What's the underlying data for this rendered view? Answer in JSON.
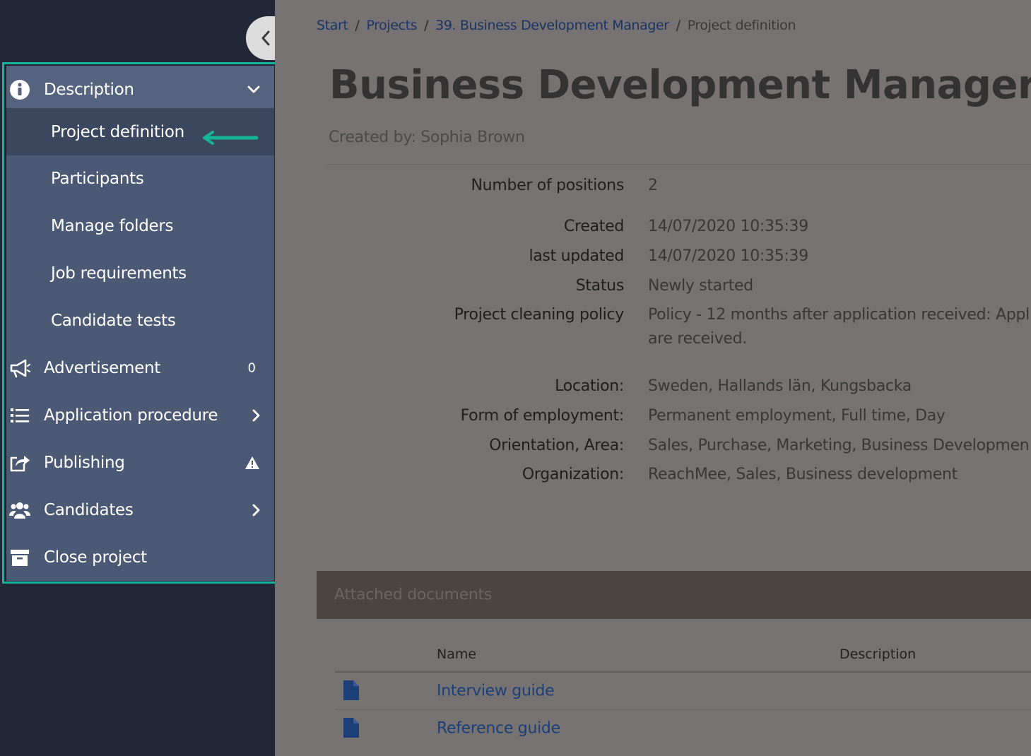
{
  "sidebar": {
    "items": [
      {
        "label": "Description",
        "icon": "info-circle-icon",
        "indicator": "chevron-down-icon"
      },
      {
        "label": "Project definition",
        "active": true
      },
      {
        "label": "Participants"
      },
      {
        "label": "Manage folders"
      },
      {
        "label": "Job requirements"
      },
      {
        "label": "Candidate tests"
      },
      {
        "label": "Advertisement",
        "icon": "megaphone-icon",
        "count": "0"
      },
      {
        "label": "Application procedure",
        "icon": "list-icon",
        "indicator": "chevron-right-icon"
      },
      {
        "label": "Publishing",
        "icon": "share-icon",
        "indicator": "warning-icon"
      },
      {
        "label": "Candidates",
        "icon": "users-icon",
        "indicator": "chevron-right-icon"
      },
      {
        "label": "Close project",
        "icon": "archive-icon"
      }
    ],
    "highlight_color": "#17b49c"
  },
  "breadcrumb": {
    "start": "Start",
    "projects": "Projects",
    "project": "39. Business Development Manager",
    "current": "Project definition"
  },
  "project": {
    "title": "Business Development Manager",
    "id": "(39)",
    "created_by": "Created by: Sophia Brown"
  },
  "details": [
    {
      "label": "Number of positions",
      "value": "2"
    },
    {
      "label": "Created",
      "value": "14/07/2020 10:35:39"
    },
    {
      "label": "last updated",
      "value": "14/07/2020 10:35:39"
    },
    {
      "label": "Status",
      "value": "Newly started"
    },
    {
      "label": "Project cleaning policy",
      "value": "Policy - 12 months after application received: Appl",
      "value2": "are received."
    },
    {
      "label": "Location:",
      "value": "Sweden, Hallands län, Kungsbacka"
    },
    {
      "label": "Form of employment:",
      "value": "Permanent employment, Full time, Day"
    },
    {
      "label": "Orientation, Area:",
      "value": "Sales, Purchase, Marketing, Business Developmen"
    },
    {
      "label": "Organization:",
      "value": "ReachMee, Sales, Business development"
    }
  ],
  "documents": {
    "title": "Attached documents",
    "columns": {
      "name": "Name",
      "description": "Description"
    },
    "rows": [
      {
        "name": "Interview guide"
      },
      {
        "name": "Reference guide"
      }
    ]
  }
}
